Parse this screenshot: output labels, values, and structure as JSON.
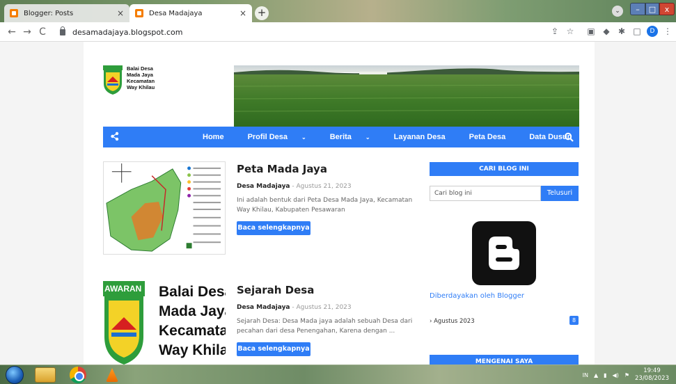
{
  "browser": {
    "tabs": [
      {
        "title": "Blogger: Posts",
        "close": "×"
      },
      {
        "title": "Desa Madajaya",
        "close": "×"
      }
    ],
    "new_tab": "+",
    "url": "desamadajaya.blogspot.com",
    "profile_initial": "D"
  },
  "site": {
    "logo_lines": [
      "Balai Desa",
      "Mada Jaya",
      "Kecamatan",
      "Way Khilau"
    ],
    "nav": [
      {
        "label": "Home",
        "dropdown": false
      },
      {
        "label": "Profil Desa",
        "dropdown": true
      },
      {
        "label": "Berita",
        "dropdown": true
      },
      {
        "label": "Layanan Desa",
        "dropdown": false
      },
      {
        "label": "Peta Desa",
        "dropdown": false
      },
      {
        "label": "Data Dusun",
        "dropdown": false
      }
    ]
  },
  "posts": [
    {
      "title": "Peta Mada Jaya",
      "author": "Desa Madajaya",
      "date": "Agustus 21, 2023",
      "snippet": "Ini adalah bentuk dari Peta Desa Mada Jaya, Kecamatan Way Khilau, Kabupaten Pesawaran",
      "read_more": "Baca selengkapnya"
    },
    {
      "title": "Sejarah Desa",
      "author": "Desa Madajaya",
      "date": "Agustus 21, 2023",
      "snippet": "Sejarah Desa: Desa Mada jaya adalah sebuah Desa dari pecahan dari desa Penengahan, Karena dengan ...",
      "read_more": "Baca selengkapnya",
      "thumb_lines": [
        "Balai Desa",
        "Mada Jaya",
        "Kecamatar",
        "Way Khilau"
      ],
      "thumb_banner": "AWARAN"
    }
  ],
  "sidebar": {
    "search_heading": "CARI BLOG INI",
    "search_placeholder": "Cari blog ini",
    "search_button": "Telusuri",
    "powered_by": "Diberdayakan oleh Blogger",
    "archive_label": "Agustus 2023",
    "archive_count": "8",
    "about_heading": "MENGENAI SAYA"
  },
  "taskbar": {
    "time": "19:49",
    "date": "23/08/2023",
    "lang": "IN"
  },
  "colors": {
    "accent": "#2f7df6",
    "blogger_orange": "#f57d00"
  }
}
